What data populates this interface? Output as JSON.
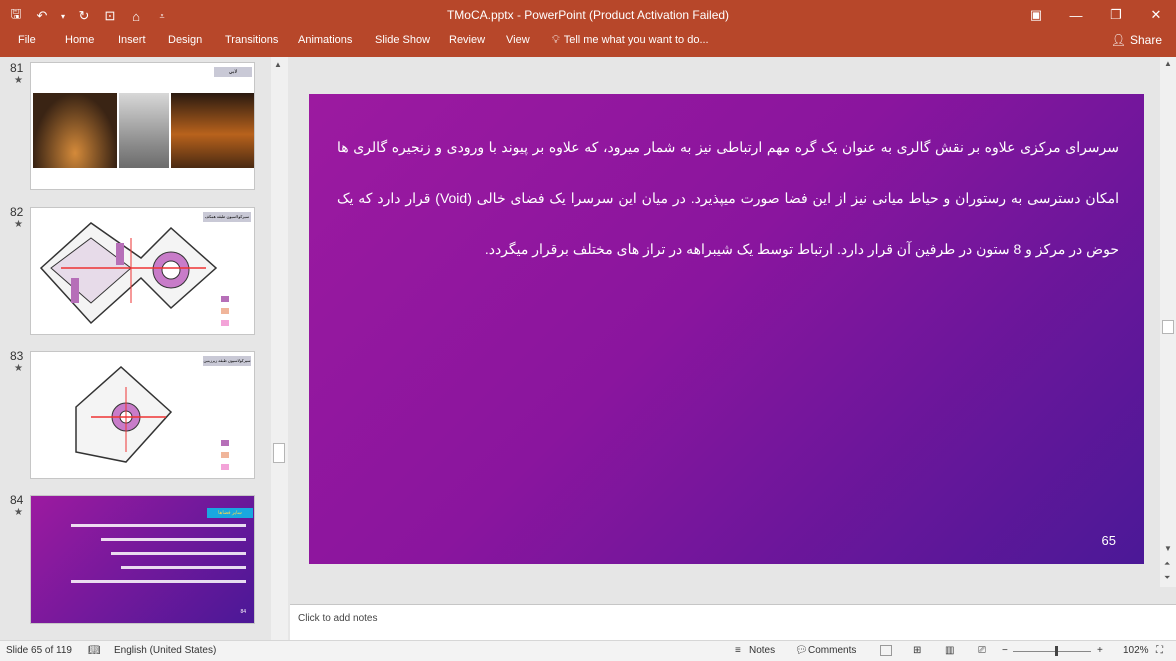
{
  "window": {
    "title": "TMoCA.pptx - PowerPoint (Product Activation Failed)"
  },
  "ribbon": {
    "tabs": [
      "File",
      "Home",
      "Insert",
      "Design",
      "Transitions",
      "Animations",
      "Slide Show",
      "Review",
      "View"
    ],
    "tell_me": "Tell me what you want to do...",
    "share": "Share"
  },
  "thumbnails": [
    {
      "num": "81",
      "star": "★",
      "caption": "لابي"
    },
    {
      "num": "82",
      "star": "★",
      "caption": "سیرکولاسیون طبقه همکف"
    },
    {
      "num": "83",
      "star": "★",
      "caption": "سیرکولاسیون طبقه زیرزمین"
    },
    {
      "num": "84",
      "star": "★",
      "caption": "سایر فضاها",
      "slide_number": "84"
    }
  ],
  "slide": {
    "text": "سرسرای مرکزی علاوه بر نقش گالری به عنوان یک گره مهم ارتباطی نیز به شمار میرود، که علاوه بر پیوند با ورودی و زنجیره گالری ها امکان دسترسی به رستوران و حیاط میانی نیز از این فضا صورت میپذیرد. در میان این سرسرا یک فضای خالی (Void) قرار دارد که یک حوض در مرکز و 8 ستون در طرفین آن قرار دارد. ارتباط توسط یک شیبراهه در تراز های مختلف برقرار میگردد.",
    "number": "65"
  },
  "notes": {
    "placeholder": "Click to add notes"
  },
  "status": {
    "slide_info": "Slide 65 of 119",
    "language": "English (United States)",
    "notes": "Notes",
    "comments": "Comments",
    "zoom": "102%"
  }
}
